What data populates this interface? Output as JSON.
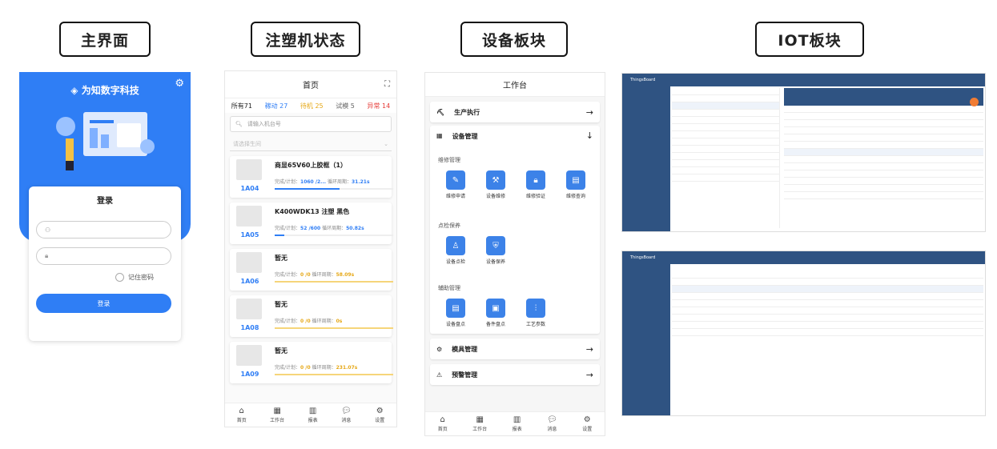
{
  "labels": {
    "main": "主界面",
    "injection": "注塑机状态",
    "device": "设备板块",
    "iot": "IOT板块"
  },
  "login": {
    "company": "为知数字科技",
    "title": "登录",
    "remember": "记住密码",
    "submit": "登录"
  },
  "injection": {
    "header": "首页",
    "filters": [
      {
        "label": "所有71",
        "color": "#222"
      },
      {
        "label": "稼动 27",
        "color": "#2f7ef5"
      },
      {
        "label": "待机 25",
        "color": "#e6a817"
      },
      {
        "label": "试模 5",
        "color": "#666"
      },
      {
        "label": "异常 14",
        "color": "#e53935"
      }
    ],
    "search_placeholder": "请输入机台号",
    "select_placeholder": "请选择生间",
    "cards": [
      {
        "code": "1A04",
        "name": "商显65V60上胶框（1）",
        "done_label": "完成/计划：",
        "done": "1060 /2...",
        "cycle_label": "循环周期：",
        "cycle": "31.21s",
        "progress": 0.55
      },
      {
        "code": "1A05",
        "name": "K400WDK13 注塑 黑色",
        "done_label": "完成/计划：",
        "done": "52 /600",
        "cycle_label": "循环周期：",
        "cycle": "50.82s",
        "progress": 0.08
      },
      {
        "code": "1A06",
        "name": "暂无",
        "done_label": "完成/计划：",
        "done": "0 /0",
        "cycle_label": "循环周期：",
        "cycle": "58.09s",
        "progress": 0
      },
      {
        "code": "1A08",
        "name": "暂无",
        "done_label": "完成/计划：",
        "done": "0 /0",
        "cycle_label": "循环周期：",
        "cycle": "0s",
        "progress": 0
      },
      {
        "code": "1A09",
        "name": "暂无",
        "done_label": "完成/计划：",
        "done": "0 /0",
        "cycle_label": "循环周期：",
        "cycle": "231.07s",
        "progress": 0
      }
    ],
    "tabs": [
      "首页",
      "工作台",
      "报表",
      "消息",
      "设置"
    ]
  },
  "device": {
    "header": "工作台",
    "production": "生产执行",
    "equipment": "设备管理",
    "section_repair": "维修管理",
    "repair_tiles": [
      "维修申请",
      "设备维修",
      "维修验证",
      "维修查询"
    ],
    "section_inspect": "点检保养",
    "inspect_tiles": [
      "设备点检",
      "设备保养"
    ],
    "section_aux": "辅助管理",
    "aux_tiles": [
      "设备盘点",
      "备件盘点",
      "工艺参数"
    ],
    "mold": "模具管理",
    "alert": "预警管理",
    "tabs": [
      "首页",
      "工作台",
      "报表",
      "消息",
      "设置"
    ]
  },
  "iot": {
    "brand": "ThingsBoard"
  }
}
